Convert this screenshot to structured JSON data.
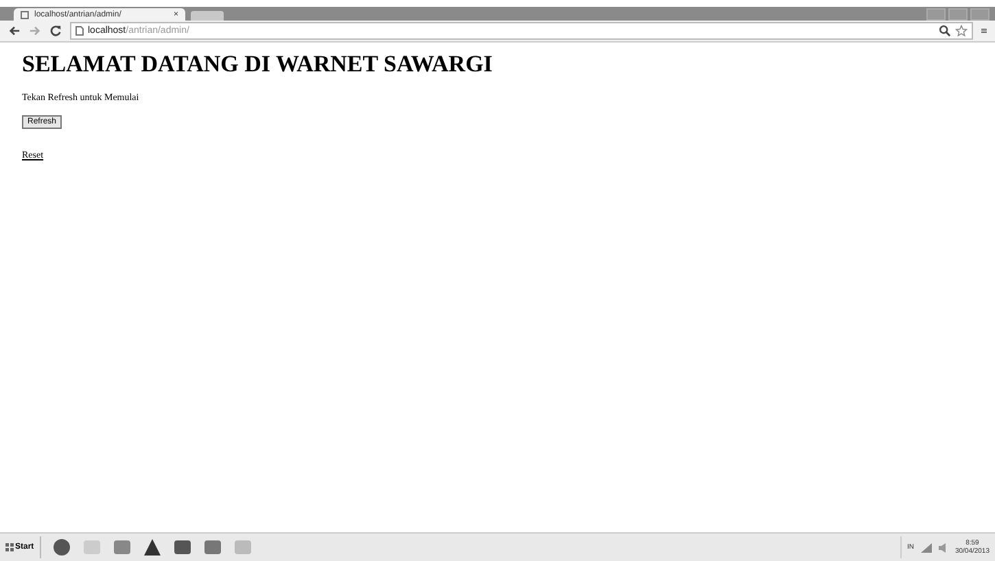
{
  "browser": {
    "tab_title": "localhost/antrian/admin/",
    "tab_close": "×",
    "url_host": "localhost",
    "url_path": "/antrian/admin/"
  },
  "page": {
    "heading": "SELAMAT DATANG DI WARNET SAWARGI",
    "instruction": "Tekan Refresh untuk Memulai",
    "button": "Refresh",
    "link": "Reset"
  },
  "taskbar": {
    "start": "Start",
    "language": "IN",
    "time": "8:59",
    "date": "30/04/2013"
  }
}
